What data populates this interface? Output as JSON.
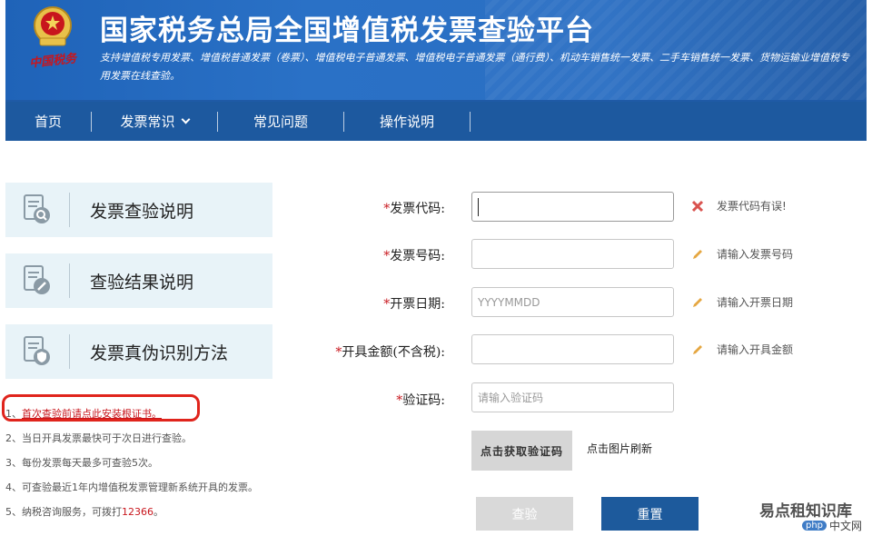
{
  "header": {
    "title": "国家税务总局全国增值税发票查验平台",
    "subtitle": "支持增值税专用发票、增值税普通发票（卷票）、增值税电子普通发票、增值税电子普通发票（通行费）、机动车销售统一发票、二手车销售统一发票、货物运输业增值税专用发票在线查验。",
    "brand": "中国税务"
  },
  "nav": {
    "items": [
      "首页",
      "发票常识",
      "常见问题",
      "操作说明"
    ]
  },
  "sidebar": {
    "cards": [
      {
        "label": "发票查验说明",
        "icon": "document-search-icon"
      },
      {
        "label": "查验结果说明",
        "icon": "document-edit-icon"
      },
      {
        "label": "发票真伪识别方法",
        "icon": "document-shield-icon"
      }
    ]
  },
  "notes": {
    "n1_prefix": "1、",
    "n1_link": "首次查验前请点此安装根证书。",
    "n2": "2、当日开具发票最快可于次日进行查验。",
    "n3": "3、每份发票每天最多可查验5次。",
    "n4": "4、可查验最近1年内增值税发票管理新系统开具的发票。",
    "n5_prefix": "5、纳税咨询服务，可拨打",
    "n5_phone": "12366",
    "n5_suffix": "。"
  },
  "form": {
    "star": "*",
    "invoice_code_label": "发票代码:",
    "invoice_code_value": "",
    "invoice_code_error": "发票代码有误!",
    "invoice_number_label": "发票号码:",
    "invoice_number_value": "",
    "invoice_number_hint": "请输入发票号码",
    "issue_date_label": "开票日期:",
    "issue_date_placeholder": "YYYYMMDD",
    "issue_date_hint": "请输入开票日期",
    "amount_label": "开具金额(不含税):",
    "amount_value": "",
    "amount_hint": "请输入开具金额",
    "captcha_label": "验证码:",
    "captcha_placeholder": "请输入验证码",
    "captcha_image_text": "点击获取验证码",
    "refresh_text": "点击图片刷新",
    "check_button": "查验",
    "reset_button": "重置"
  },
  "watermark": {
    "line1": "易点租知识库",
    "php": "php",
    "site": "中文网"
  },
  "colors": {
    "header_blue": "#1f63b8",
    "nav_blue": "#1d599f",
    "error_red": "#c8161d",
    "button_blue": "#1d5a9c",
    "disabled_gray": "#d9d9d9"
  }
}
